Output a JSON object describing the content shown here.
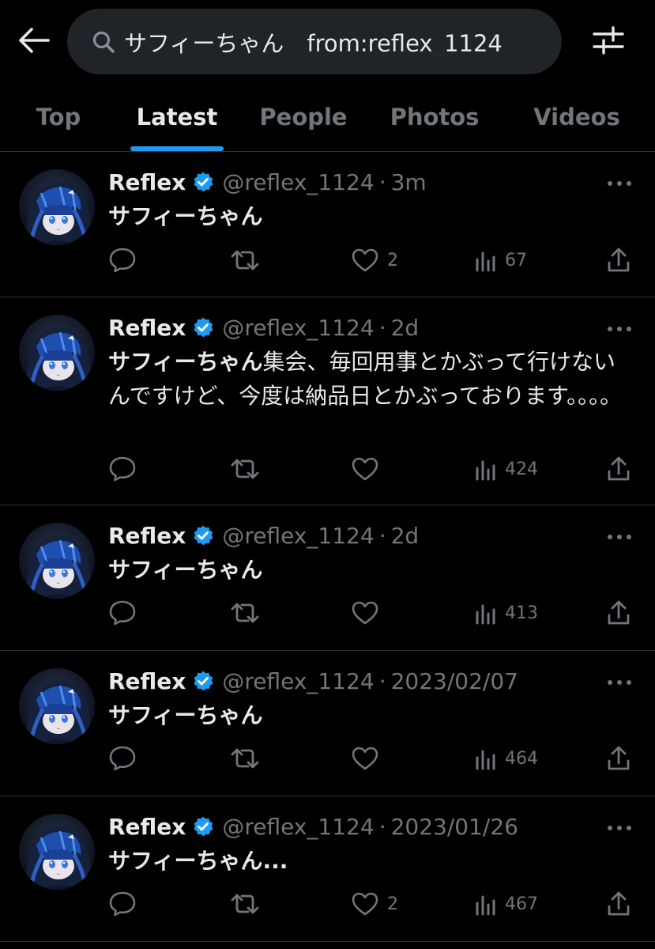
{
  "search": {
    "query": "サフィーちゃん　from:reflex_1124"
  },
  "tabs": [
    {
      "label": "Top"
    },
    {
      "label": "Latest"
    },
    {
      "label": "People"
    },
    {
      "label": "Photos"
    },
    {
      "label": "Videos"
    }
  ],
  "active_tab": "Latest",
  "icons": {
    "back": "arrow-left-icon",
    "search": "search-icon",
    "filter": "sliders-icon",
    "verified": "verified-badge-icon",
    "reply": "reply-icon",
    "retweet": "retweet-icon",
    "like": "heart-icon",
    "views": "views-icon",
    "share": "share-icon",
    "more": "more-icon"
  },
  "colors": {
    "accent": "#1d9bf0",
    "background": "#000000",
    "search_bg": "#202327",
    "muted_text": "#71767b",
    "primary_text": "#e7e9ea",
    "divider": "#2f3336"
  },
  "tweets": [
    {
      "name": "Reflex",
      "handle": "@reflex_1124",
      "sep": "·",
      "time": "3m",
      "text_bold": "サフィーちゃん",
      "text_rest": "",
      "likes": "2",
      "views": "67"
    },
    {
      "name": "Reflex",
      "handle": "@reflex_1124",
      "sep": "·",
      "time": "2d",
      "text_bold": "サフィーちゃん",
      "text_rest": "集会、毎回用事とかぶって行けないんですけど、今度は納品日とかぶっております。。。。",
      "likes": "",
      "views": "424"
    },
    {
      "name": "Reflex",
      "handle": "@reflex_1124",
      "sep": "·",
      "time": "2d",
      "text_bold": "サフィーちゃん",
      "text_rest": "",
      "likes": "",
      "views": "413"
    },
    {
      "name": "Reflex",
      "handle": "@reflex_1124",
      "sep": "·",
      "time": "2023/02/07",
      "text_bold": "サフィーちゃん",
      "text_rest": "",
      "likes": "",
      "views": "464"
    },
    {
      "name": "Reflex",
      "handle": "@reflex_1124",
      "sep": "·",
      "time": "2023/01/26",
      "text_bold": "サフィーちゃん...",
      "text_rest": "",
      "likes": "2",
      "views": "467"
    }
  ]
}
